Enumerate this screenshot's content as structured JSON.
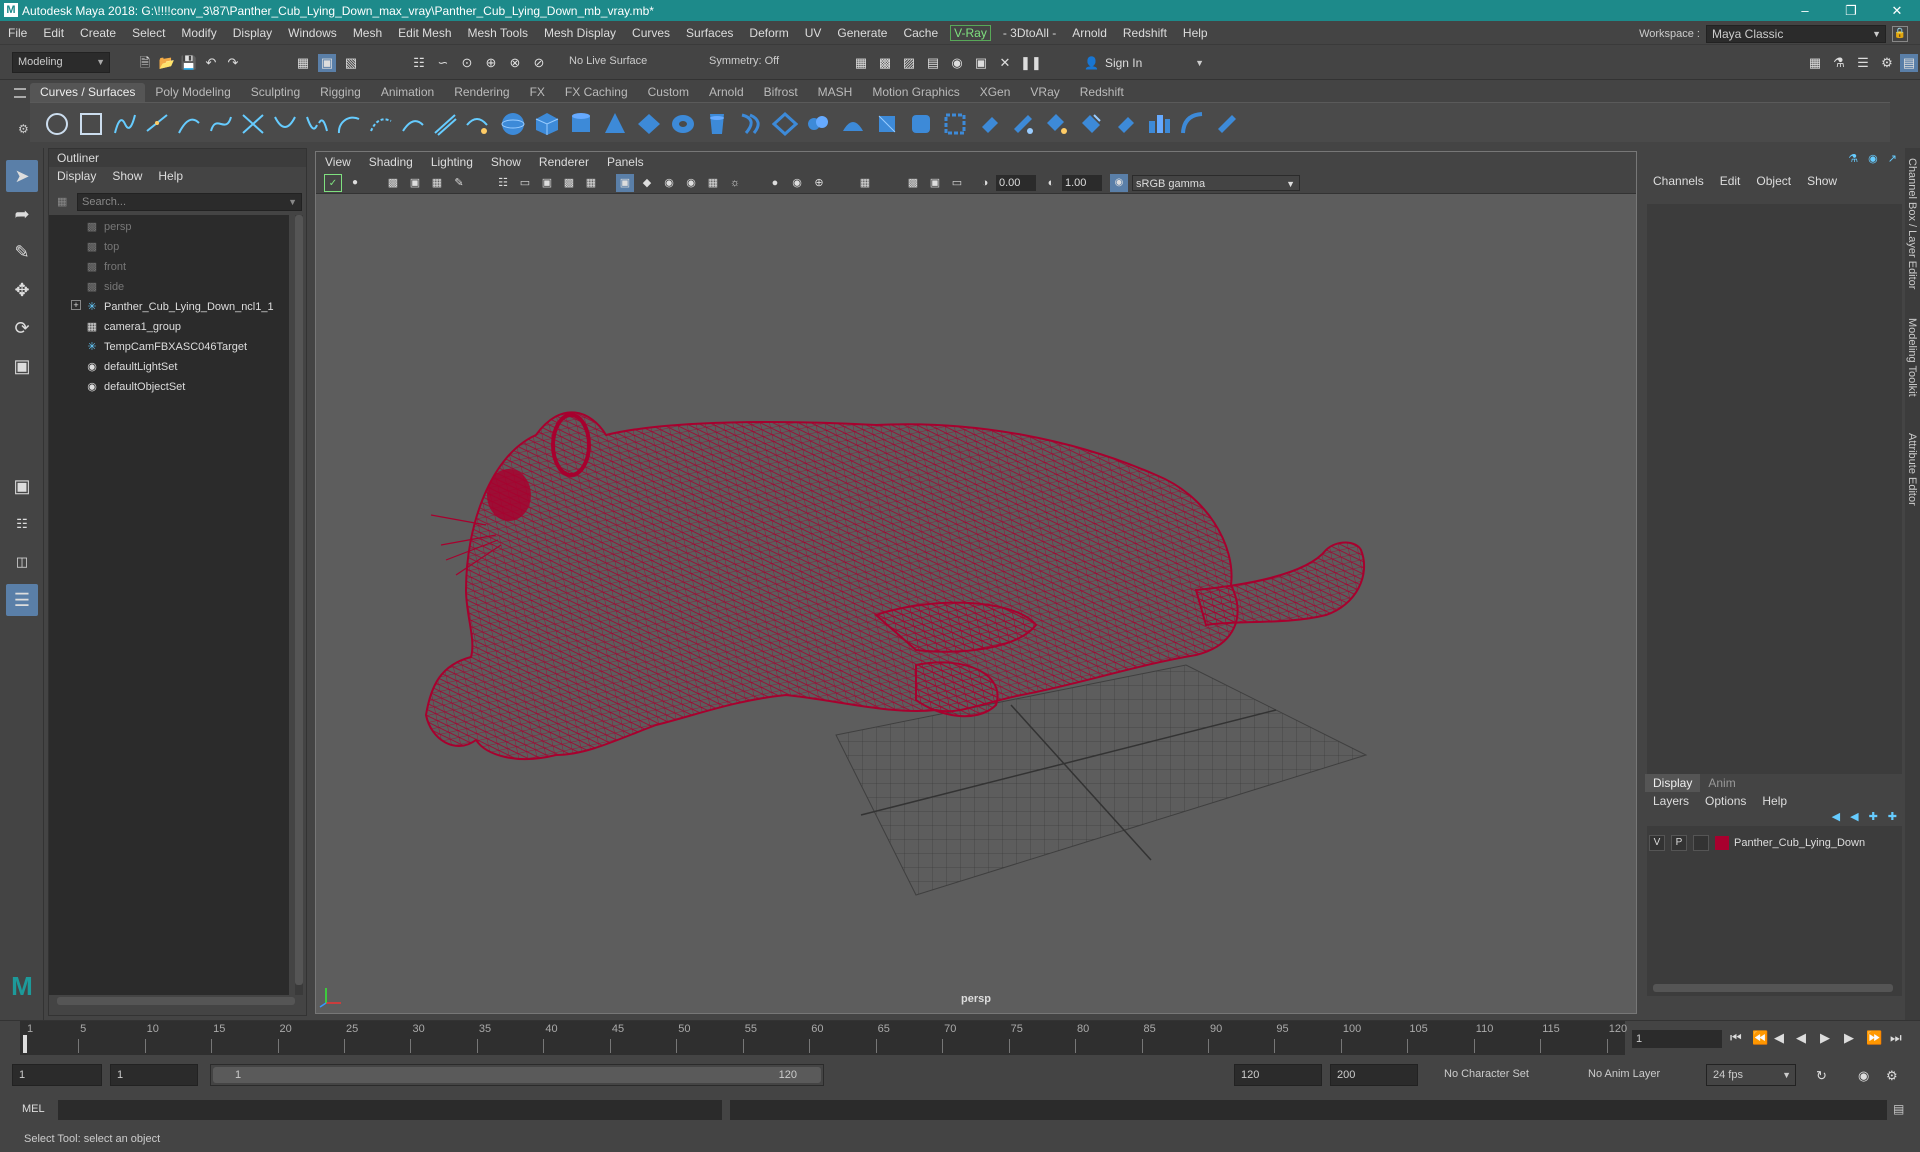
{
  "title": "Autodesk Maya 2018: G:\\!!!!conv_3\\87\\Panther_Cub_Lying_Down_max_vray\\Panther_Cub_Lying_Down_mb_vray.mb*",
  "menus": [
    "File",
    "Edit",
    "Create",
    "Select",
    "Modify",
    "Display",
    "Windows",
    "Mesh",
    "Edit Mesh",
    "Mesh Tools",
    "Mesh Display",
    "Curves",
    "Surfaces",
    "Deform",
    "UV",
    "Generate",
    "Cache"
  ],
  "menus_vray": "V-Ray",
  "menus_after": [
    "- 3DtoAll -",
    "Arnold",
    "Redshift",
    "Help"
  ],
  "workspace": {
    "label": "Workspace :",
    "value": "Maya Classic"
  },
  "statusline": {
    "mode": "Modeling",
    "live_surface": "No Live Surface",
    "symmetry": "Symmetry: Off",
    "sign_in": "Sign In"
  },
  "shelf_tabs": [
    "Curves / Surfaces",
    "Poly Modeling",
    "Sculpting",
    "Rigging",
    "Animation",
    "Rendering",
    "FX",
    "FX Caching",
    "Custom",
    "Arnold",
    "Bifrost",
    "MASH",
    "Motion Graphics",
    "XGen",
    "VRay",
    "Redshift"
  ],
  "outliner": {
    "title": "Outliner",
    "menu": [
      "Display",
      "Show",
      "Help"
    ],
    "search_placeholder": "Search...",
    "items": [
      {
        "label": "persp",
        "icon": "camera-icon",
        "dim": true
      },
      {
        "label": "top",
        "icon": "camera-icon",
        "dim": true
      },
      {
        "label": "front",
        "icon": "camera-icon",
        "dim": true
      },
      {
        "label": "side",
        "icon": "camera-icon",
        "dim": true
      },
      {
        "label": "Panther_Cub_Lying_Down_ncl1_1",
        "icon": "transform-icon",
        "dim": false,
        "expandable": true
      },
      {
        "label": "camera1_group",
        "icon": "group-icon",
        "dim": false
      },
      {
        "label": "TempCamFBXASC046Target",
        "icon": "transform-icon",
        "dim": false
      },
      {
        "label": "defaultLightSet",
        "icon": "set-icon",
        "dim": false
      },
      {
        "label": "defaultObjectSet",
        "icon": "set-icon",
        "dim": false
      }
    ]
  },
  "viewport": {
    "menu": [
      "View",
      "Shading",
      "Lighting",
      "Show",
      "Renderer",
      "Panels"
    ],
    "exposure": "0.00",
    "gamma": "1.00",
    "color_space": "sRGB gamma",
    "camera_label": "persp",
    "wire_color": "#a8002e"
  },
  "channel_box": {
    "menu": [
      "Channels",
      "Edit",
      "Object",
      "Show"
    ]
  },
  "layer_editor": {
    "tabs": [
      "Display",
      "Anim"
    ],
    "menu": [
      "Layers",
      "Options",
      "Help"
    ],
    "layer": {
      "v": "V",
      "p": "P",
      "name": "Panther_Cub_Lying_Down",
      "color": "#a8002e"
    }
  },
  "side_tabs": [
    "Channel Box / Layer Editor",
    "Modeling Toolkit",
    "Attribute Editor"
  ],
  "timeline": {
    "ticks": [
      1,
      5,
      10,
      15,
      20,
      25,
      30,
      35,
      40,
      45,
      50,
      55,
      60,
      65,
      70,
      75,
      80,
      85,
      90,
      95,
      100,
      105,
      110,
      115,
      120
    ],
    "current_frame": "1"
  },
  "range": {
    "start": "1",
    "playback_start": "1",
    "slider_start": "1",
    "slider_end": "120",
    "playback_end": "120",
    "end": "200",
    "character_set": "No Character Set",
    "anim_layer": "No Anim Layer",
    "fps": "24 fps"
  },
  "command_line": {
    "label": "MEL"
  },
  "help_line": "Select Tool: select an object"
}
